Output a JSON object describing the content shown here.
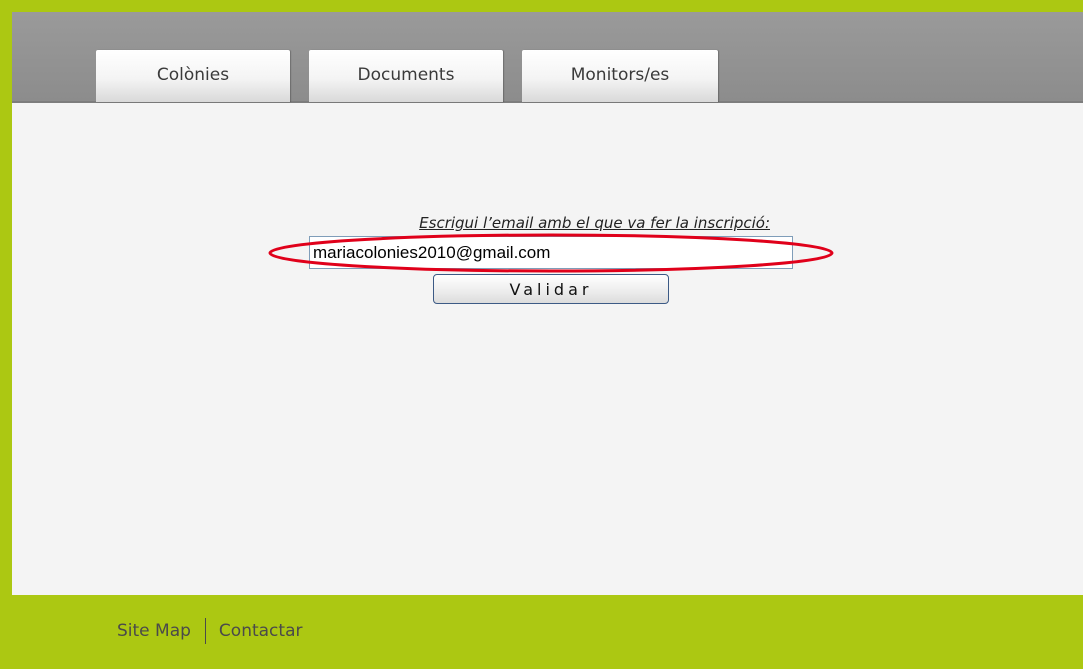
{
  "tabs": [
    {
      "label": "Colònies"
    },
    {
      "label": "Documents"
    },
    {
      "label": "Monitors/es"
    }
  ],
  "form": {
    "prompt": "Escrigui l’email amb el que va fer la inscripció:",
    "email_value": "mariacolonies2010@gmail.com",
    "validate_label": "Validar"
  },
  "footer": {
    "links": [
      {
        "label": "Site Map"
      },
      {
        "label": "Contactar"
      }
    ]
  },
  "colors": {
    "frame_green": "#acc812",
    "header_gray": "#929292",
    "content_bg": "#f4f4f4",
    "highlight_red": "#e0001a"
  }
}
